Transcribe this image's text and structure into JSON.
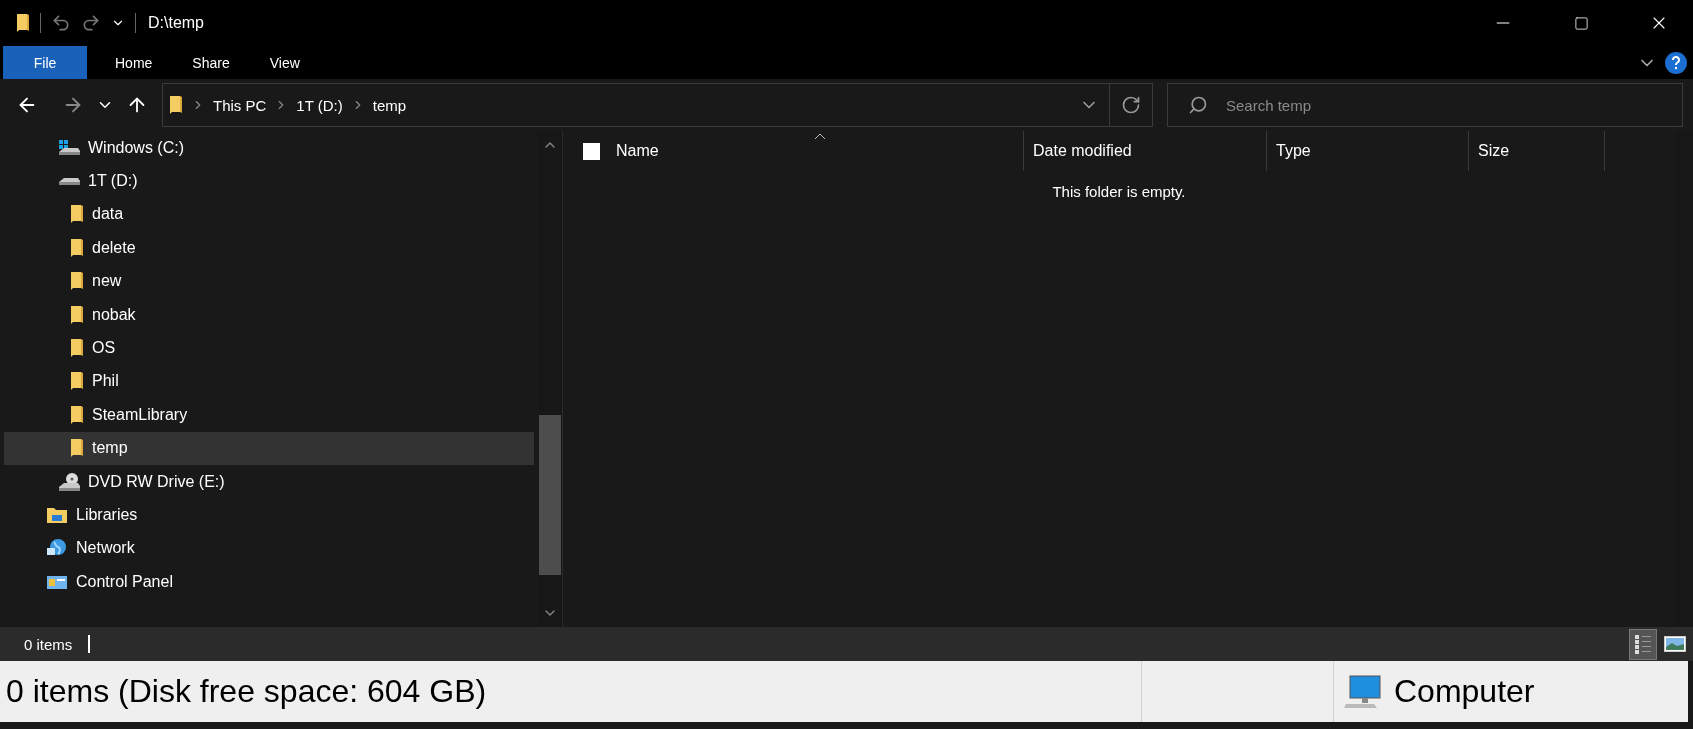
{
  "window": {
    "title": "D:\\temp"
  },
  "ribbon_tabs": [
    {
      "label": "File",
      "selected": true
    },
    {
      "label": "Home",
      "selected": false
    },
    {
      "label": "Share",
      "selected": false
    },
    {
      "label": "View",
      "selected": false
    }
  ],
  "address_bar": {
    "crumbs": [
      "This PC",
      "1T (D:)",
      "temp"
    ]
  },
  "search": {
    "placeholder": "Search temp"
  },
  "nav_tree": {
    "drives": [
      {
        "label": "Windows (C:)",
        "kind": "system-drive",
        "selected": false
      },
      {
        "label": "1T (D:)",
        "kind": "drive",
        "selected": false,
        "children": [
          {
            "label": "data",
            "selected": false
          },
          {
            "label": "delete",
            "selected": false
          },
          {
            "label": "new",
            "selected": false
          },
          {
            "label": "nobak",
            "selected": false
          },
          {
            "label": "OS",
            "selected": false
          },
          {
            "label": "Phil",
            "selected": false
          },
          {
            "label": "SteamLibrary",
            "selected": false
          },
          {
            "label": "temp",
            "selected": true
          }
        ]
      },
      {
        "label": "DVD RW Drive (E:)",
        "kind": "dvd",
        "selected": false
      }
    ],
    "locations": [
      {
        "label": "Libraries",
        "kind": "libraries",
        "selected": false
      },
      {
        "label": "Network",
        "kind": "network",
        "selected": false
      },
      {
        "label": "Control Panel",
        "kind": "control-panel",
        "selected": false
      }
    ]
  },
  "file_list": {
    "select_all_checked": false,
    "columns": [
      {
        "label": "Name",
        "sorted": true
      },
      {
        "label": "Date modified",
        "sorted": false
      },
      {
        "label": "Type",
        "sorted": false
      },
      {
        "label": "Size",
        "sorted": false
      }
    ],
    "empty_message": "This folder is empty."
  },
  "status_bar": {
    "text": "0 items",
    "view_buttons": [
      {
        "kind": "details",
        "selected": true
      },
      {
        "kind": "large-icons",
        "selected": false
      }
    ]
  },
  "details_bar": {
    "text": "0 items (Disk free space: 604 GB)",
    "location": "Computer"
  }
}
